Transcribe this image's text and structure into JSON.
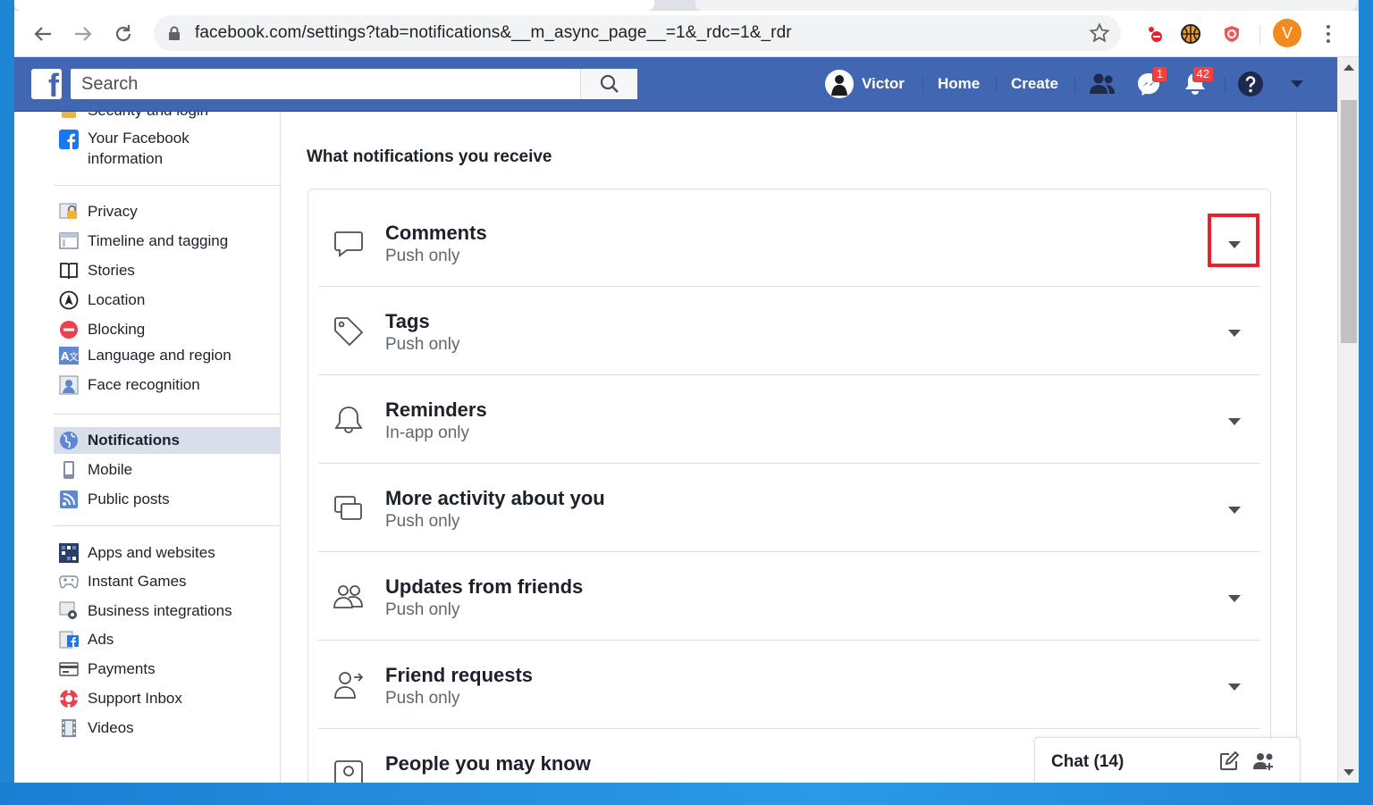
{
  "browser": {
    "url": "facebook.com/settings?tab=notifications&__m_async_page__=1&_rdc=1&_rdr",
    "profile_initial": "V"
  },
  "fb": {
    "search_placeholder": "Search",
    "user_name": "Victor",
    "nav_home": "Home",
    "nav_create": "Create",
    "messenger_badge": "1",
    "notifications_badge": "42",
    "brand_color": "#4267b2"
  },
  "sidebar": {
    "partial_top": "Security and login",
    "group1": [
      {
        "label": "Your Facebook information",
        "icon": "facebook-icon"
      }
    ],
    "group2": [
      {
        "label": "Privacy",
        "icon": "privacy-lock-icon"
      },
      {
        "label": "Timeline and tagging",
        "icon": "timeline-icon"
      },
      {
        "label": "Stories",
        "icon": "book-icon"
      },
      {
        "label": "Location",
        "icon": "location-icon"
      },
      {
        "label": "Blocking",
        "icon": "blocking-icon"
      },
      {
        "label": "Language and region",
        "icon": "language-icon"
      },
      {
        "label": "Face recognition",
        "icon": "face-recognition-icon"
      }
    ],
    "group3": [
      {
        "label": "Notifications",
        "icon": "globe-icon",
        "active": true
      },
      {
        "label": "Mobile",
        "icon": "mobile-icon"
      },
      {
        "label": "Public posts",
        "icon": "rss-icon"
      }
    ],
    "group4": [
      {
        "label": "Apps and websites",
        "icon": "apps-icon"
      },
      {
        "label": "Instant Games",
        "icon": "gamepad-icon"
      },
      {
        "label": "Business integrations",
        "icon": "business-gear-icon"
      },
      {
        "label": "Ads",
        "icon": "ads-icon"
      },
      {
        "label": "Payments",
        "icon": "payment-card-icon"
      },
      {
        "label": "Support Inbox",
        "icon": "lifebuoy-icon"
      },
      {
        "label": "Videos",
        "icon": "film-icon"
      }
    ]
  },
  "main": {
    "section_title": "What notifications you receive",
    "rows": [
      {
        "title": "Comments",
        "subtitle": "Push only",
        "icon": "comment-bubble-icon",
        "highlighted": true
      },
      {
        "title": "Tags",
        "subtitle": "Push only",
        "icon": "tag-icon"
      },
      {
        "title": "Reminders",
        "subtitle": "In-app only",
        "icon": "bell-icon"
      },
      {
        "title": "More activity about you",
        "subtitle": "Push only",
        "icon": "activity-windows-icon"
      },
      {
        "title": "Updates from friends",
        "subtitle": "Push only",
        "icon": "friends-icon"
      },
      {
        "title": "Friend requests",
        "subtitle": "Push only",
        "icon": "friend-request-icon"
      },
      {
        "title": "People you may know",
        "subtitle": "",
        "icon": "people-know-icon"
      }
    ],
    "highlight_color": "#e8222b"
  },
  "chat": {
    "label": "Chat (14)"
  }
}
